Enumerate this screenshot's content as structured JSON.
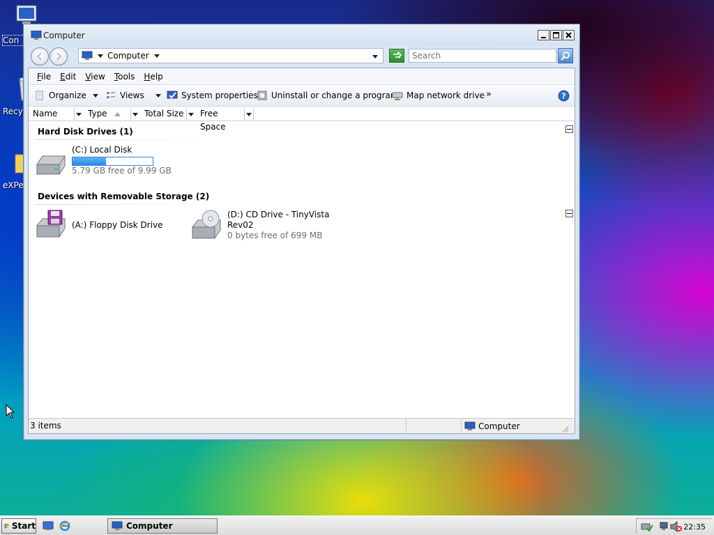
{
  "desktop": {
    "icons": [
      {
        "label": "Con"
      },
      {
        "label": "Recy"
      },
      {
        "label": "eXPe"
      }
    ]
  },
  "window": {
    "title": "Computer",
    "address": {
      "location": "Computer"
    },
    "search": {
      "placeholder": "Search"
    },
    "menu": [
      "File",
      "Edit",
      "View",
      "Tools",
      "Help"
    ],
    "commands": {
      "organize": "Organize",
      "views": "Views",
      "system_properties": "System properties",
      "uninstall": "Uninstall or change a program",
      "map_drive": "Map network drive",
      "more": "»"
    },
    "columns": [
      "Name",
      "Type",
      "Total Size",
      "Free Space"
    ],
    "groups": {
      "hard_disks": {
        "title": "Hard Disk Drives (1)",
        "drives": [
          {
            "name": "(C:) Local Disk",
            "free_text": "5.79 GB free of 9.99 GB",
            "used_fraction": 0.42
          }
        ]
      },
      "removable": {
        "title": "Devices with Removable Storage (2)",
        "drives": [
          {
            "name": "(A:) Floppy Disk Drive"
          },
          {
            "name_line1": "(D:) CD Drive - TinyVista",
            "name_line2": "Rev02",
            "free_text": "0 bytes free of 699 MB"
          }
        ]
      }
    },
    "status": {
      "items": "3 items",
      "location": "Computer"
    }
  },
  "taskbar": {
    "start_label": "Start",
    "task_label": "Computer",
    "clock": "22:35"
  },
  "colors": {
    "accent": "#268ae6",
    "title_bg": "#d5e2f1"
  }
}
